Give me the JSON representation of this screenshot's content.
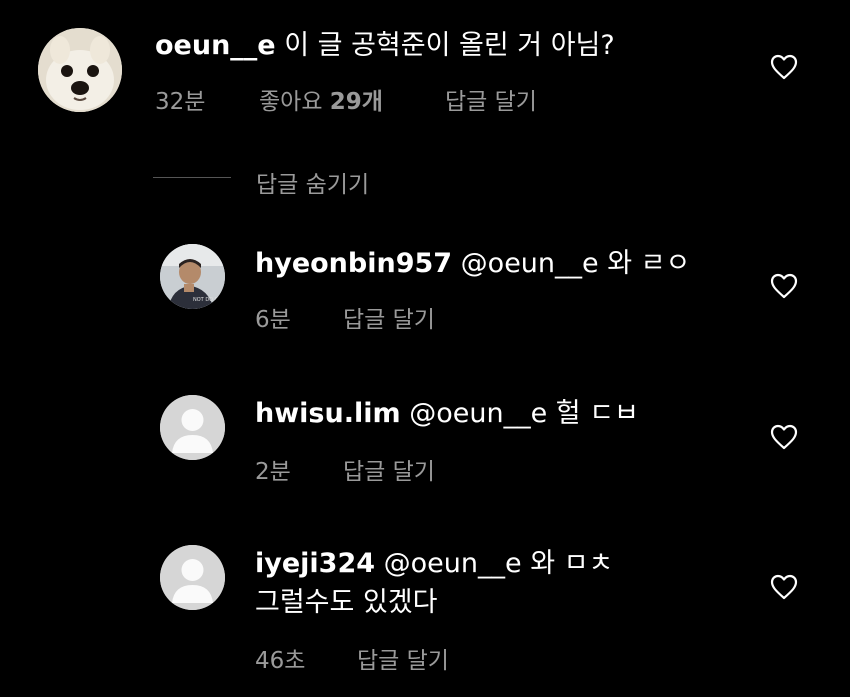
{
  "main_comment": {
    "username": "oeun__e",
    "text": "이 글 공혁준이 올린 거 아님?",
    "time": "32분",
    "likes_label": "좋아요",
    "likes_count": "29개",
    "reply_label": "답글 달기"
  },
  "hide_replies_label": "답글 숨기기",
  "replies": [
    {
      "username": "hyeonbin957",
      "mention": "@oeun__e",
      "text": "와 ㄹㅇ",
      "time": "6분",
      "reply_label": "답글 달기",
      "avatar_caption": "NOT DO IT"
    },
    {
      "username": "hwisu.lim",
      "mention": "@oeun__e",
      "text": "헐 ㄷㅂ",
      "time": "2분",
      "reply_label": "답글 달기"
    },
    {
      "username": "iyeji324",
      "mention": "@oeun__e",
      "text": "와 ㅁㅊ",
      "text_line2": "그럴수도 있겠다",
      "time": "46초",
      "reply_label": "답글 달기"
    }
  ],
  "icons": {
    "heart": "heart-outline-icon",
    "default_avatar": "default-avatar-icon"
  },
  "colors": {
    "background": "#000000",
    "text": "#ffffff",
    "secondary": "#9a9a9a",
    "avatar_placeholder": "#d6d6d6"
  }
}
